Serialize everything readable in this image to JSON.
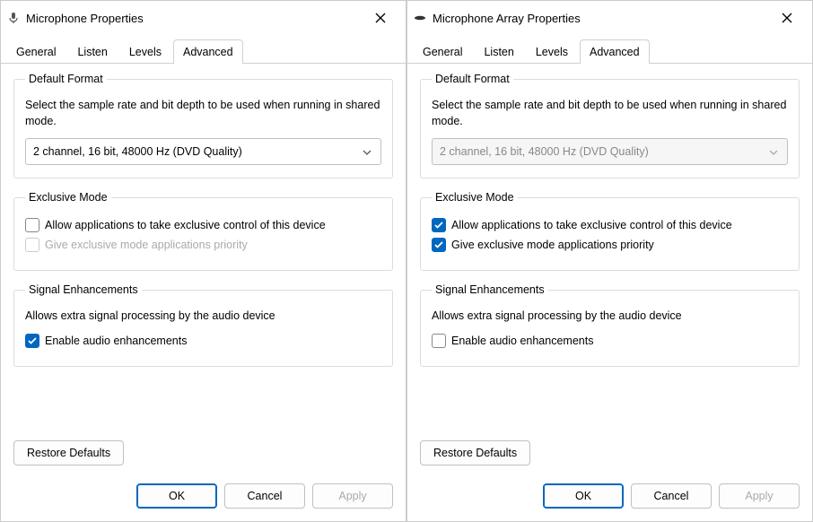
{
  "dialogs": [
    {
      "title": "Microphone Properties",
      "icon": "mic-icon",
      "tabs": [
        "General",
        "Listen",
        "Levels",
        "Advanced"
      ],
      "active_tab": 3,
      "default_format": {
        "legend": "Default Format",
        "desc": "Select the sample rate and bit depth to be used when running in shared mode.",
        "value": "2 channel, 16 bit, 48000 Hz (DVD Quality)",
        "enabled": true
      },
      "exclusive": {
        "legend": "Exclusive Mode",
        "allow_label": "Allow applications to take exclusive control of this device",
        "allow_checked": false,
        "allow_enabled": true,
        "priority_label": "Give exclusive mode applications priority",
        "priority_checked": false,
        "priority_enabled": false
      },
      "signal": {
        "legend": "Signal Enhancements",
        "desc": "Allows extra signal processing by the audio device",
        "enable_label": "Enable audio enhancements",
        "enable_checked": true
      },
      "restore_label": "Restore Defaults",
      "ok_label": "OK",
      "cancel_label": "Cancel",
      "apply_label": "Apply",
      "apply_enabled": false
    },
    {
      "title": "Microphone Array Properties",
      "icon": "mic-array-icon",
      "tabs": [
        "General",
        "Listen",
        "Levels",
        "Advanced"
      ],
      "active_tab": 3,
      "default_format": {
        "legend": "Default Format",
        "desc": "Select the sample rate and bit depth to be used when running in shared mode.",
        "value": "2 channel, 16 bit, 48000 Hz (DVD Quality)",
        "enabled": false
      },
      "exclusive": {
        "legend": "Exclusive Mode",
        "allow_label": "Allow applications to take exclusive control of this device",
        "allow_checked": true,
        "allow_enabled": true,
        "priority_label": "Give exclusive mode applications priority",
        "priority_checked": true,
        "priority_enabled": true
      },
      "signal": {
        "legend": "Signal Enhancements",
        "desc": "Allows extra signal processing by the audio device",
        "enable_label": "Enable audio enhancements",
        "enable_checked": false
      },
      "restore_label": "Restore Defaults",
      "ok_label": "OK",
      "cancel_label": "Cancel",
      "apply_label": "Apply",
      "apply_enabled": false
    }
  ]
}
